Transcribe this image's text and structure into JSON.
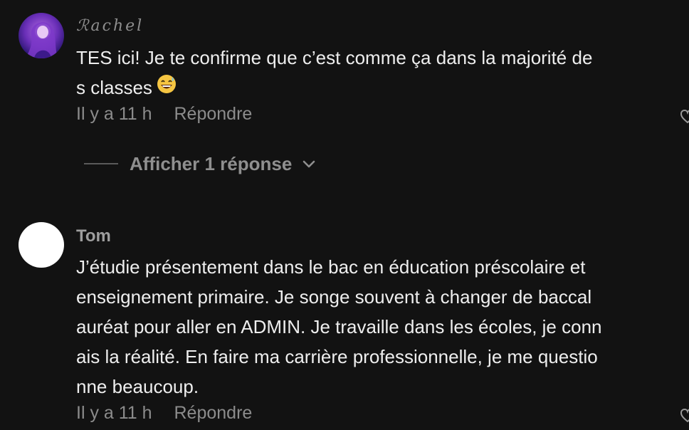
{
  "comments": [
    {
      "username": "ℛachel",
      "lines": [
        "TES ici! Je te confirme que c’est comme ça dans la majorité de",
        "s classes"
      ],
      "emoji": "grinning-sweat-emoji",
      "time": "Il y a 11 h",
      "reply_label": "Répondre",
      "show_replies_label": "Afficher 1 réponse"
    },
    {
      "username": "Tom",
      "lines": [
        "J’étudie présentement dans le bac en éducation préscolaire et",
        "enseignement primaire. Je songe souvent à changer de baccal",
        "auréat pour aller en ADMIN. Je travaille dans les écoles, je conn",
        "ais la réalité. En faire ma carrière professionnelle, je me questio",
        "nne beaucoup."
      ],
      "time": "Il y a 11 h",
      "reply_label": "Répondre"
    }
  ],
  "icons": {
    "like": "heart-icon",
    "expand": "chevron-down-icon"
  },
  "colors": {
    "background": "#121212",
    "text": "#eeeeee",
    "muted": "#8c8c8c"
  }
}
